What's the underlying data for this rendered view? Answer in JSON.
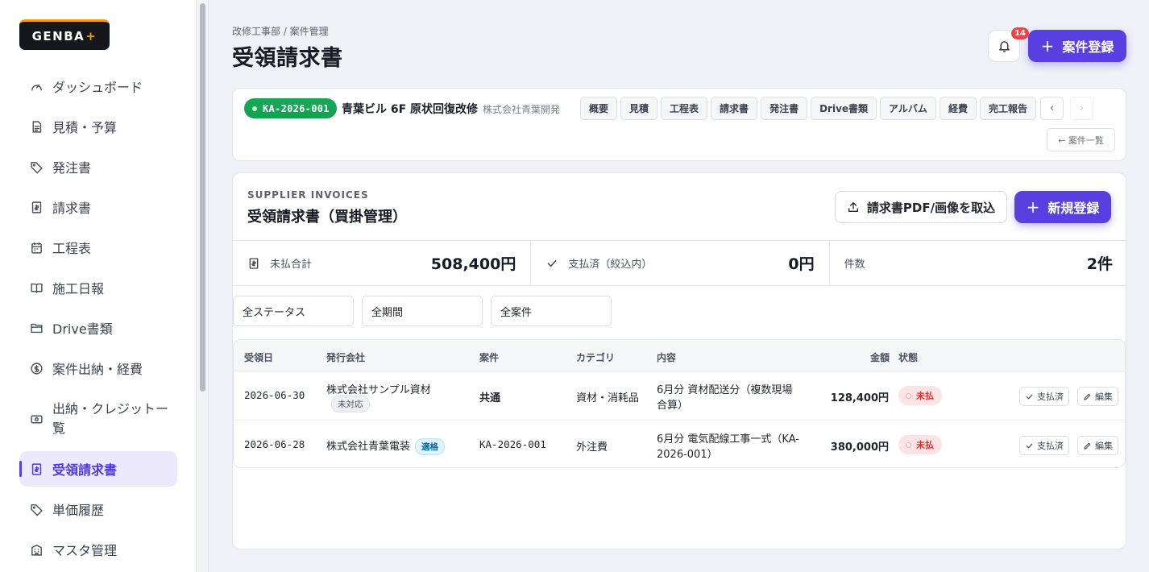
{
  "brand": {
    "name": "GENBA",
    "plus": "+"
  },
  "sidebar": {
    "items": [
      {
        "label": "ダッシュボード",
        "icon": "gauge-icon"
      },
      {
        "label": "見積・予算",
        "icon": "document-icon"
      },
      {
        "label": "発注書",
        "icon": "tag-icon"
      },
      {
        "label": "請求書",
        "icon": "receipt-icon"
      },
      {
        "label": "工程表",
        "icon": "calendar-icon"
      },
      {
        "label": "施工日報",
        "icon": "book-icon"
      },
      {
        "label": "Drive書類",
        "icon": "folder-icon"
      },
      {
        "label": "案件出納・経費",
        "icon": "dollar-circle-icon"
      },
      {
        "label": "出納・クレジット一覧",
        "label_line1": "出納・クレジットー",
        "label_line2": "覧",
        "icon": "cash-icon"
      },
      {
        "label": "受領請求書",
        "icon": "receipt-icon",
        "active": true
      },
      {
        "label": "単価履歴",
        "icon": "tag-icon"
      },
      {
        "label": "マスタ管理",
        "icon": "building-icon"
      }
    ]
  },
  "header": {
    "breadcrumb": "改修工事部 / 案件管理",
    "title": "受領請求書",
    "notification_count": "14",
    "register_label": "案件登録"
  },
  "project": {
    "code": "KA-2026-001",
    "name": "青葉ビル 6F 原状回復改修",
    "client": "株式会社青葉開発",
    "tabs": [
      "概要",
      "見積",
      "工程表",
      "請求書",
      "発注書",
      "Drive書類",
      "アルバム",
      "経費",
      "完工報告"
    ],
    "prev": "‹",
    "next": "›",
    "back_label": "← 案件一覧"
  },
  "card": {
    "eyebrow": "SUPPLIER INVOICES",
    "title": "受領請求書（買掛管理）",
    "import_label": "請求書PDF/画像を取込",
    "new_label": "新規登録"
  },
  "stats": [
    {
      "label": "未払合計",
      "value": "508,400円",
      "icon": "receipt-icon"
    },
    {
      "label": "支払済（絞込内）",
      "value": "0円",
      "icon": "check-icon"
    },
    {
      "label": "件数",
      "value": "2件"
    }
  ],
  "filters": [
    "全ステータス",
    "全期間",
    "全案件"
  ],
  "table": {
    "headers": [
      "受領日",
      "発行会社",
      "案件",
      "カテゴリ",
      "内容",
      "金額",
      "状態"
    ],
    "rows": [
      {
        "date": "2026-06-30",
        "company": "株式会社サンプル資材",
        "company_badge": "未対応",
        "project": "共通",
        "category": "資材・消耗品",
        "content_line1": "6月分 資材配送分（複数現場",
        "content_line2": "合算）",
        "amount": "128,400円",
        "status": "未払",
        "pay_label": "支払済",
        "edit_label": "編集"
      },
      {
        "date": "2026-06-28",
        "company": "株式会社青葉電装",
        "company_badge": "適格",
        "project": "KA-2026-001",
        "category": "外注費",
        "content_line1": "6月分 電気配線工事一式（KA-",
        "content_line2": "2026-001）",
        "amount": "380,000円",
        "status": "未払",
        "pay_label": "支払済",
        "edit_label": "編集"
      }
    ]
  },
  "colors": {
    "accent": "#5a3fe0",
    "success": "#16a34a",
    "danger": "#d92e2e"
  }
}
